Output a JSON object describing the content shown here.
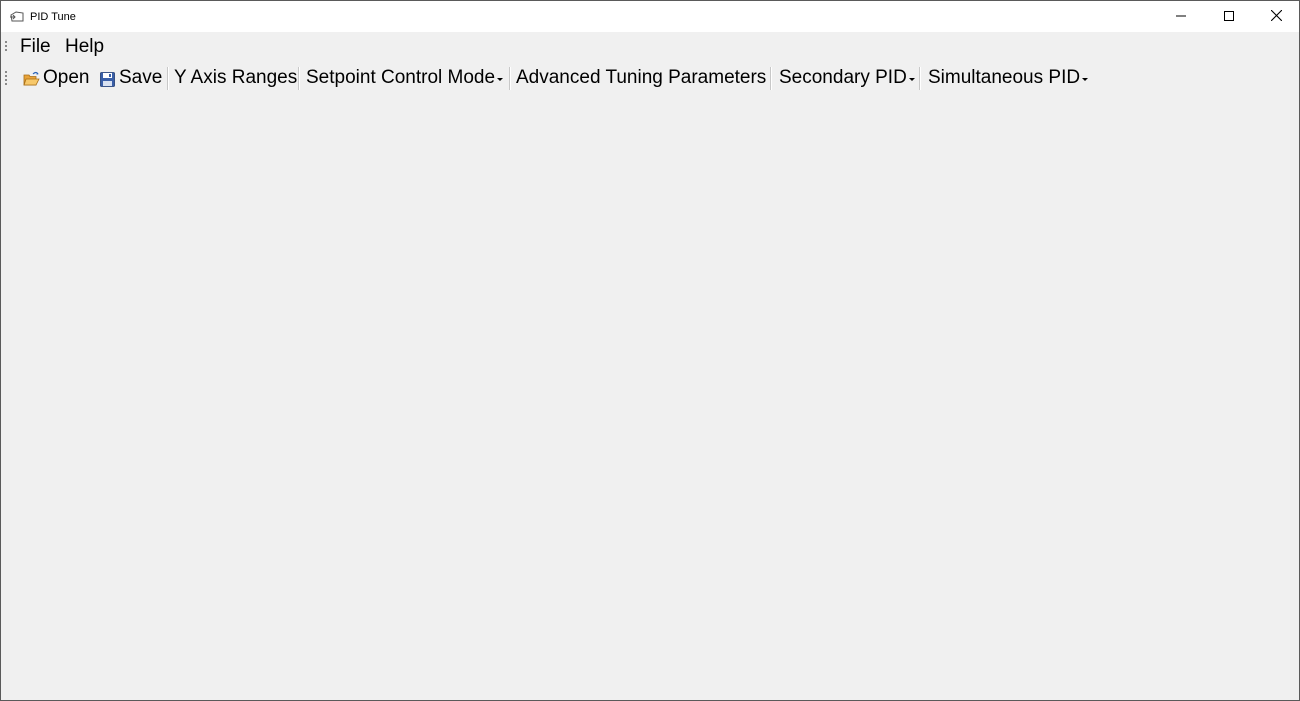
{
  "window": {
    "title": "PID Tune",
    "app_icon": "pid-tune-app-icon",
    "controls": {
      "minimize_icon": "minimize-icon",
      "maximize_icon": "maximize-icon",
      "close_icon": "close-icon"
    }
  },
  "menubar": {
    "items": [
      {
        "label": "File"
      },
      {
        "label": "Help"
      }
    ]
  },
  "toolbar": {
    "open_label": "Open",
    "open_icon": "open-folder-icon",
    "save_label": "Save",
    "save_icon": "floppy-disk-icon",
    "y_axis_label": "Y Axis Ranges",
    "setpoint_label": "Setpoint Control Mode",
    "advanced_label": "Advanced Tuning Parameters",
    "secondary_label": "Secondary PID",
    "simultaneous_label": "Simultaneous PID"
  },
  "colors": {
    "window_background": "#f0f0f0",
    "titlebar_background": "#ffffff",
    "border": "#5a5a5a"
  }
}
